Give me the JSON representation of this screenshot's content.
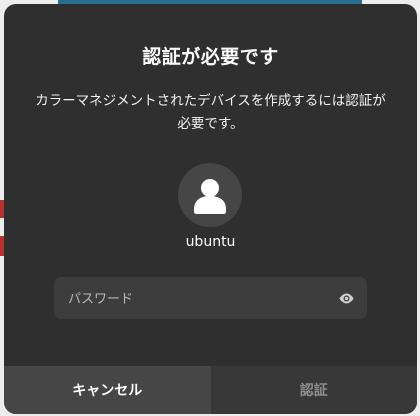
{
  "dialog": {
    "title": "認証が必要です",
    "message": "カラーマネジメントされたデバイスを作成するには認証が必要です。",
    "username": "ubuntu",
    "avatar_icon": "user-avatar-icon"
  },
  "password": {
    "placeholder": "パスワード",
    "value": "",
    "reveal_icon": "eye-icon"
  },
  "buttons": {
    "cancel_label": "キャンセル",
    "authenticate_label": "認証"
  },
  "colors": {
    "dialog_bg": "#2f2f2f",
    "cancel_bg": "#464646",
    "auth_bg": "#383838",
    "auth_text_disabled": "#8e8e8e"
  }
}
